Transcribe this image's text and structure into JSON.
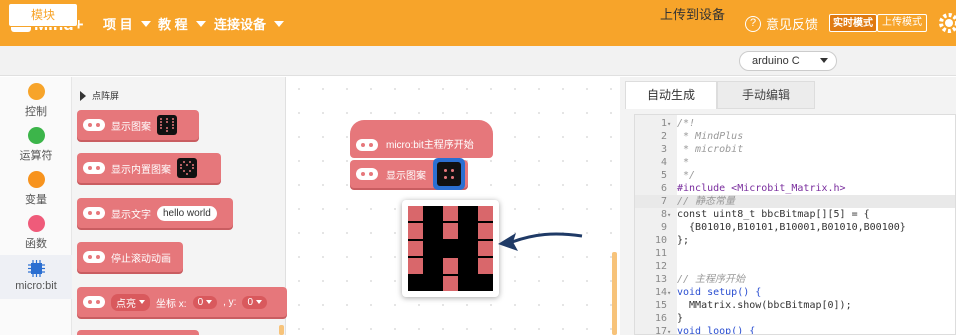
{
  "header": {
    "logo_text": "Mind+",
    "menu": [
      {
        "label": "项 目"
      },
      {
        "label": "教 程"
      },
      {
        "label": "连接设备"
      }
    ],
    "feedback_label": "意见反馈",
    "mode_live": "实时模式",
    "mode_upload": "上传模式"
  },
  "toolbar": {
    "modules_tab": "模块",
    "upload_label": "上传到设备",
    "board_select": "arduino C"
  },
  "categories": [
    {
      "label": "控制",
      "color": "#f7a42a"
    },
    {
      "label": "运算符",
      "color": "#3cb54a"
    },
    {
      "label": "变量",
      "color": "#f7931e"
    },
    {
      "label": "函数",
      "color": "#ef5b7a"
    },
    {
      "label": "micro:bit",
      "color": "#2b6fd1",
      "icon": "chip-icon",
      "active": true
    }
  ],
  "flyout": {
    "header": "点阵屏",
    "blocks": [
      {
        "label": "显示图案"
      },
      {
        "label": "显示内置图案"
      },
      {
        "label": "显示文字",
        "value": "hello world"
      },
      {
        "label": "停止滚动动画"
      },
      {
        "label": "点亮",
        "coord_label": "坐标 x:",
        "x": "0",
        "y_label": ", y:",
        "y": "0"
      }
    ]
  },
  "workspace": {
    "hat_block": "micro:bit主程序开始",
    "display_block": "显示图案",
    "matrix": [
      [
        1,
        0,
        1,
        0,
        1
      ],
      [
        1,
        0,
        1,
        0,
        1
      ],
      [
        1,
        0,
        0,
        0,
        1
      ],
      [
        1,
        0,
        1,
        0,
        1
      ],
      [
        0,
        0,
        1,
        0,
        0
      ]
    ]
  },
  "editor": {
    "tabs": [
      "自动生成",
      "手动编辑"
    ],
    "lines": [
      {
        "n": "1",
        "fold": true,
        "text": "/*!",
        "cls": "c-comment"
      },
      {
        "n": "2",
        "text": " * MindPlus",
        "cls": "c-comment"
      },
      {
        "n": "3",
        "text": " * microbit",
        "cls": "c-comment"
      },
      {
        "n": "4",
        "text": " *",
        "cls": "c-comment"
      },
      {
        "n": "5",
        "text": " */",
        "cls": "c-comment"
      },
      {
        "n": "6",
        "text": "#include <Microbit_Matrix.h>",
        "cls": "c-pre"
      },
      {
        "n": "7",
        "text": "// 静态常量",
        "cls": "c-comment",
        "hl": true
      },
      {
        "n": "8",
        "fold": true,
        "text": "const uint8_t bbcBitmap[][5] = {",
        "cls": ""
      },
      {
        "n": "9",
        "text": "  {B01010,B10101,B10001,B01010,B00100}",
        "cls": ""
      },
      {
        "n": "10",
        "text": "};",
        "cls": ""
      },
      {
        "n": "11",
        "text": "",
        "cls": ""
      },
      {
        "n": "12",
        "text": "",
        "cls": ""
      },
      {
        "n": "13",
        "text": "// 主程序开始",
        "cls": "c-comment"
      },
      {
        "n": "14",
        "fold": true,
        "text": "void setup() {",
        "cls": "c-kw"
      },
      {
        "n": "15",
        "text": "  MMatrix.show(bbcBitmap[0]);",
        "cls": ""
      },
      {
        "n": "16",
        "text": "}",
        "cls": ""
      },
      {
        "n": "17",
        "fold": true,
        "text": "void loop() {",
        "cls": "c-kw"
      }
    ]
  }
}
